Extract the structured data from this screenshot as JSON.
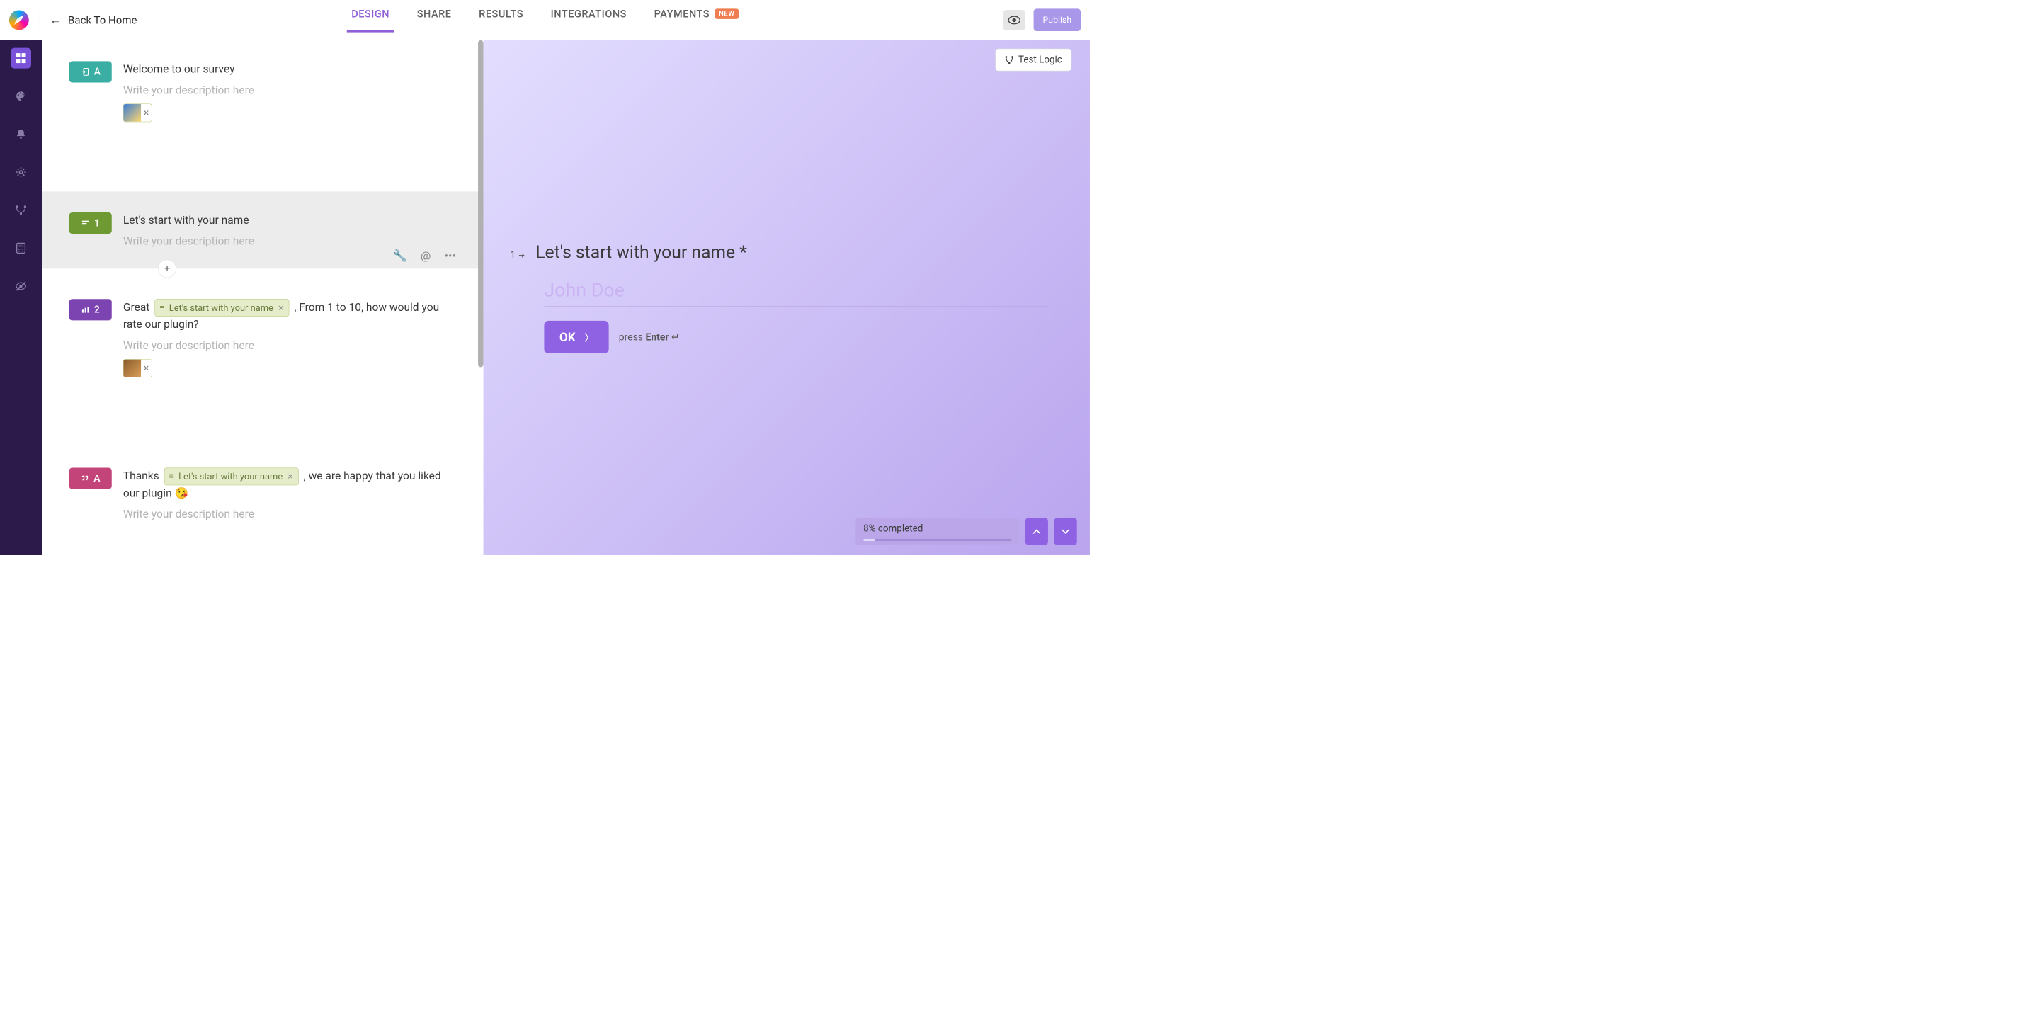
{
  "topbar": {
    "back_label": "Back To Home",
    "tabs": [
      "DESIGN",
      "SHARE",
      "RESULTS",
      "INTEGRATIONS",
      "PAYMENTS"
    ],
    "new_badge": "NEW",
    "publish_label": "Publish"
  },
  "questions": [
    {
      "badge_letter": "A",
      "title": "Welcome to our survey",
      "desc_placeholder": "Write your description here",
      "has_thumb": true
    },
    {
      "badge_letter": "1",
      "title": "Let's start with your name",
      "desc_placeholder": "Write your description here"
    },
    {
      "badge_letter": "2",
      "title_pre": "Great ",
      "ref_text": "Let's start with your name",
      "title_post": " , From 1 to 10, how would you rate our plugin?",
      "desc_placeholder": "Write your description here",
      "has_thumb": true
    },
    {
      "badge_letter": "A",
      "title_pre": "Thanks ",
      "ref_text": "Let's start with your name",
      "title_post": " , we are happy that you liked our plugin 😘",
      "desc_placeholder": "Write your description here"
    }
  ],
  "preview": {
    "test_logic": "Test Logic",
    "q_number": "1",
    "title": "Let's start with your name *",
    "input_value": "John Doe",
    "ok_label": "OK",
    "press_text": "press ",
    "enter_word": "Enter",
    "enter_symbol": " ↵",
    "progress_text": "8% completed",
    "progress_percent": 8
  }
}
